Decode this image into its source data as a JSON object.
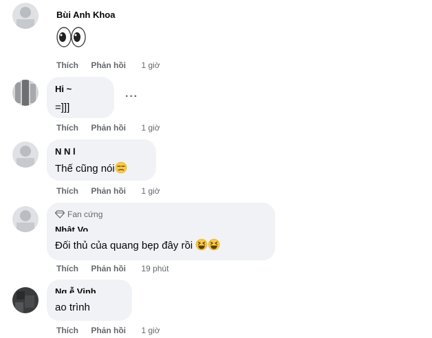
{
  "comments": [
    {
      "name": "Bùi Anh Khoa",
      "text": "",
      "emoji": "eyes",
      "actions": {
        "like": "Thích",
        "reply": "Phản hồi",
        "time": "1 giờ"
      }
    },
    {
      "name": "Hi   ~",
      "text": "=]]]",
      "actions": {
        "like": "Thích",
        "reply": "Phản hồi",
        "time": "1 giờ"
      },
      "more": "···"
    },
    {
      "name": "N  N  l",
      "text": "Thế cũng nói",
      "emoji": "unamused",
      "actions": {
        "like": "Thích",
        "reply": "Phản hồi",
        "time": "1 giờ"
      }
    },
    {
      "badge": "Fan cứng",
      "name": "Nhật Vo",
      "text": "Đối thủ của quang bẹp đây rồi",
      "emoji": "laughing",
      "actions": {
        "like": "Thích",
        "reply": "Phản hồi",
        "time": "19 phút"
      }
    },
    {
      "name": "Ng  ễ  Vinh",
      "text": "ao trình",
      "actions": {
        "like": "Thích",
        "reply": "Phản hồi",
        "time": "1 giờ"
      }
    }
  ]
}
